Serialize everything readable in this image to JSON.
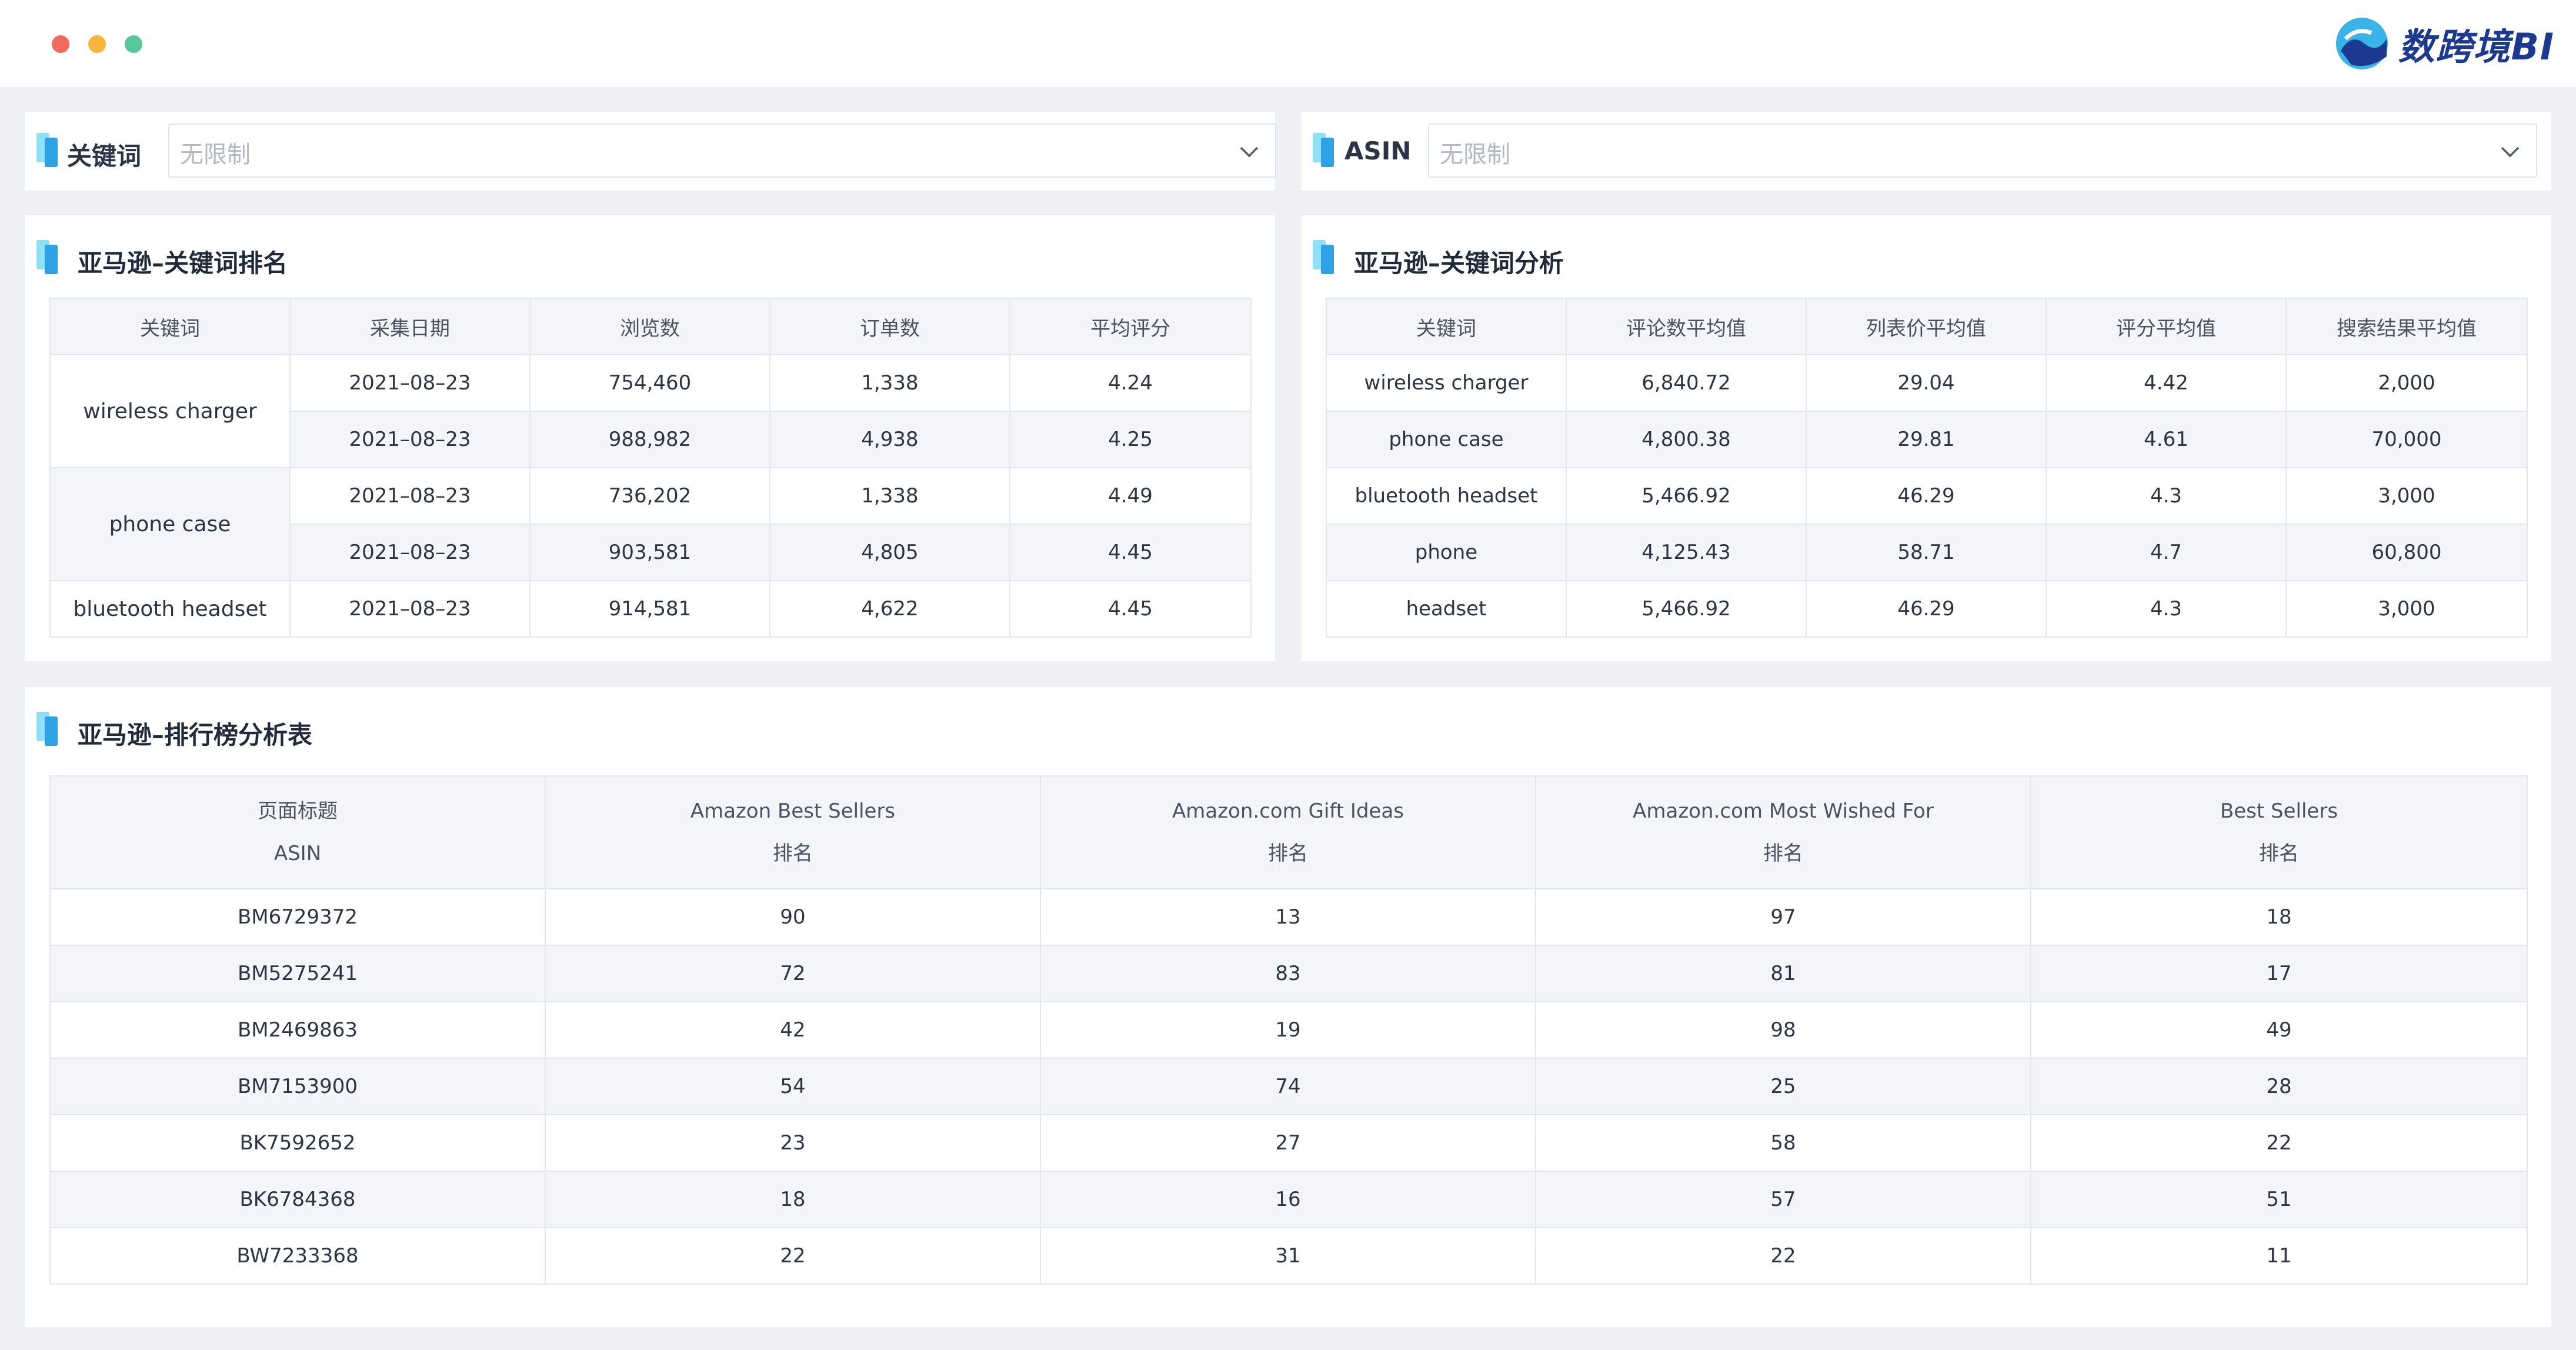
{
  "window": {
    "traffic_colors": [
      "#f06a5f",
      "#f6b63c",
      "#58c79a"
    ],
    "logo_text": "数跨境BI"
  },
  "filters": {
    "keyword": {
      "label": "关键词",
      "placeholder": "无限制"
    },
    "asin": {
      "label": "ASIN",
      "placeholder": "无限制"
    }
  },
  "keyword_rank": {
    "title": "亚马逊–关键词排名",
    "headers": [
      "关键词",
      "采集日期",
      "浏览数",
      "订单数",
      "平均评分"
    ],
    "groups": [
      {
        "keyword": "wireless charger",
        "rows": [
          {
            "date": "2021–08–23",
            "views": "754,460",
            "orders": "1,338",
            "rating": "4.24"
          },
          {
            "date": "2021–08–23",
            "views": "988,982",
            "orders": "4,938",
            "rating": "4.25"
          }
        ]
      },
      {
        "keyword": "phone case",
        "rows": [
          {
            "date": "2021–08–23",
            "views": "736,202",
            "orders": "1,338",
            "rating": "4.49"
          },
          {
            "date": "2021–08–23",
            "views": "903,581",
            "orders": "4,805",
            "rating": "4.45"
          }
        ]
      },
      {
        "keyword": "bluetooth headset",
        "rows": [
          {
            "date": "2021–08–23",
            "views": "914,581",
            "orders": "4,622",
            "rating": "4.45"
          }
        ]
      }
    ]
  },
  "keyword_analysis": {
    "title": "亚马逊–关键词分析",
    "headers": [
      "关键词",
      "评论数平均值",
      "列表价平均值",
      "评分平均值",
      "搜索结果平均值"
    ],
    "rows": [
      [
        "wireless charger",
        "6,840.72",
        "29.04",
        "4.42",
        "2,000"
      ],
      [
        "phone case",
        "4,800.38",
        "29.81",
        "4.61",
        "70,000"
      ],
      [
        "bluetooth headset",
        "5,466.92",
        "46.29",
        "4.3",
        "3,000"
      ],
      [
        "phone",
        "4,125.43",
        "58.71",
        "4.7",
        "60,800"
      ],
      [
        "headset",
        "5,466.92",
        "46.29",
        "4.3",
        "3,000"
      ]
    ]
  },
  "ranking": {
    "title": "亚马逊–排行榜分析表",
    "headers": [
      {
        "top": "页面标题",
        "bottom": "ASIN"
      },
      {
        "top": "Amazon Best Sellers",
        "bottom": "排名"
      },
      {
        "top": "Amazon.com Gift Ideas",
        "bottom": "排名"
      },
      {
        "top": "Amazon.com Most Wished For",
        "bottom": "排名"
      },
      {
        "top": "Best Sellers",
        "bottom": "排名"
      }
    ],
    "rows": [
      [
        "BM6729372",
        "90",
        "13",
        "97",
        "18"
      ],
      [
        "BM5275241",
        "72",
        "83",
        "81",
        "17"
      ],
      [
        "BM2469863",
        "42",
        "19",
        "98",
        "49"
      ],
      [
        "BM7153900",
        "54",
        "74",
        "25",
        "28"
      ],
      [
        "BK7592652",
        "23",
        "27",
        "58",
        "22"
      ],
      [
        "BK6784368",
        "18",
        "16",
        "57",
        "51"
      ],
      [
        "BW7233368",
        "22",
        "31",
        "22",
        "11"
      ]
    ]
  }
}
